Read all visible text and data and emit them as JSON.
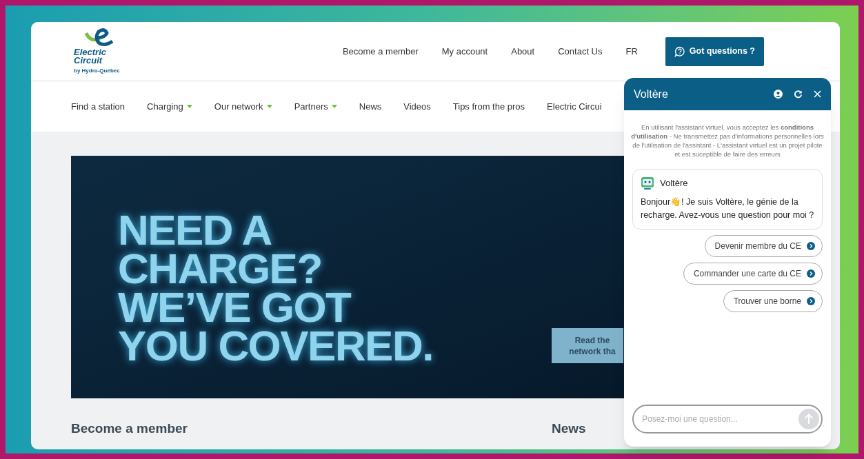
{
  "logo": {
    "name": "Electric Circuit",
    "byline": "by Hydro-Québec"
  },
  "top_nav": {
    "links": [
      "Become a member",
      "My account",
      "About",
      "Contact Us",
      "FR"
    ],
    "cta": "Got questions ?"
  },
  "main_nav": [
    {
      "label": "Find a station",
      "dropdown": false
    },
    {
      "label": "Charging",
      "dropdown": true
    },
    {
      "label": "Our network",
      "dropdown": true
    },
    {
      "label": "Partners",
      "dropdown": true
    },
    {
      "label": "News",
      "dropdown": false
    },
    {
      "label": "Videos",
      "dropdown": false
    },
    {
      "label": "Tips from the pros",
      "dropdown": false
    },
    {
      "label": "Electric Circui",
      "dropdown": false
    }
  ],
  "hero": {
    "headline": [
      "NEED A",
      "CHARGE?",
      "WE’VE GOT",
      "YOU COVERED."
    ],
    "button_lines": [
      "Read the",
      "network tha"
    ]
  },
  "sections": [
    "Become a member",
    "News"
  ],
  "chat": {
    "title": "Voltère",
    "disclaimer": "En utilisant l'assistant virtuel, vous acceptez les **conditions d'utilisation** - Ne transmettez pas d'informations personnelles lors de l'utilisation de l'assistant - L'assistant virtuel est un projet pilote et est suceptible de faire des erreurs",
    "message": {
      "sender": "Voltère",
      "text_before": "Bonjour",
      "emoji": "👋",
      "text_after": "! Je suis Voltère, le génie de la recharge. Avez-vous une question pour moi ?"
    },
    "quick_replies": [
      "Devenir membre du CE",
      "Commander une carte du CE",
      "Trouver une borne"
    ],
    "input": {
      "placeholder": "Posez-moi une question..."
    }
  }
}
